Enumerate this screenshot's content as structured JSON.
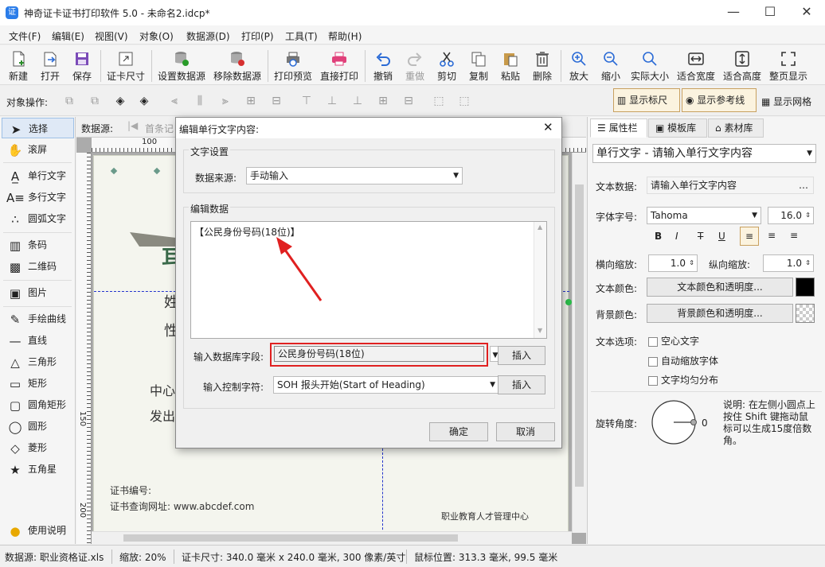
{
  "window": {
    "title": "神奇证卡证书打印软件 5.0 - 未命名2.idcp*"
  },
  "menu": [
    "文件(F)",
    "编辑(E)",
    "视图(V)",
    "对象(O)",
    "数据源(D)",
    "打印(P)",
    "工具(T)",
    "帮助(H)"
  ],
  "toolbar": [
    "新建",
    "打开",
    "保存",
    "证卡尺寸",
    "设置数据源",
    "移除数据源",
    "打印预览",
    "直接打印",
    "撤销",
    "重做",
    "剪切",
    "复制",
    "粘贴",
    "删除",
    "放大",
    "缩小",
    "实际大小",
    "适合宽度",
    "适合高度",
    "整页显示"
  ],
  "objbar": {
    "label": "对象操作:",
    "show_ruler": "显示标尺",
    "show_guides": "显示参考线",
    "show_grid": "显示网格"
  },
  "tools": [
    "选择",
    "滚屏",
    "单行文字",
    "多行文字",
    "圆弧文字",
    "条码",
    "二维码",
    "图片",
    "手绘曲线",
    "直线",
    "三角形",
    "矩形",
    "圆角矩形",
    "圆形",
    "菱形",
    "五角星",
    "使用说明"
  ],
  "canvas": {
    "datasource_label": "数据源:",
    "first_record": "首条记",
    "ruler_top_100": "100",
    "ruler_left": [
      "150",
      "200"
    ],
    "cert_text": {
      "c1": "耳",
      "c2": "姓",
      "c3": "性",
      "c4": "中心",
      "c5": "发出",
      "cert_no": "证书编号:",
      "query_url": "证书查询网址: www.abcdef.com",
      "issuer": "职业教育人才管理中心"
    }
  },
  "rightpanel": {
    "tabs": [
      "属性栏",
      "模板库",
      "素材库"
    ],
    "object_selector": "单行文字 - 请输入单行文字内容",
    "text_data_label": "文本数据:",
    "text_data_value": "请输入单行文字内容",
    "font_label": "字体字号:",
    "font_name": "Tahoma",
    "font_size": "16.0",
    "h_scale_label": "横向缩放:",
    "h_scale": "1.0",
    "v_scale_label": "纵向缩放:",
    "v_scale": "1.0",
    "text_color_label": "文本颜色:",
    "text_color_btn": "文本颜色和透明度...",
    "bg_color_label": "背景颜色:",
    "bg_color_btn": "背景颜色和透明度...",
    "text_options_label": "文本选项:",
    "options": [
      "空心文字",
      "自动缩放字体",
      "文字均匀分布"
    ],
    "rotate_label": "旋转角度:",
    "rotate_value": "0",
    "rotate_help": "说明: 在左侧小圆点上按住 Shift 键拖动鼠标可以生成15度倍数角。",
    "text_color": "#000000"
  },
  "dialog": {
    "title": "编辑单行文字内容:",
    "text_settings": "文字设置",
    "datasource_label": "数据来源:",
    "datasource_value": "手动输入",
    "edit_data": "编辑数据",
    "content": "【公民身份号码(18位)】",
    "db_field_label": "输入数据库字段:",
    "db_field_value": "公民身份号码(18位)",
    "insert": "插入",
    "ctrl_char_label": "输入控制字符:",
    "ctrl_char_value": "SOH  报头开始(Start of Heading)",
    "ok": "确定",
    "cancel": "取消",
    "highlight_color": "#e02020"
  },
  "status": {
    "datasource": "数据源: 职业资格证.xls",
    "zoom": "缩放: 20%",
    "card_size": "证卡尺寸: 340.0 毫米 x 240.0 毫米, 300 像素/英寸",
    "mouse_pos": "鼠标位置: 313.3 毫米, 99.5 毫米"
  }
}
